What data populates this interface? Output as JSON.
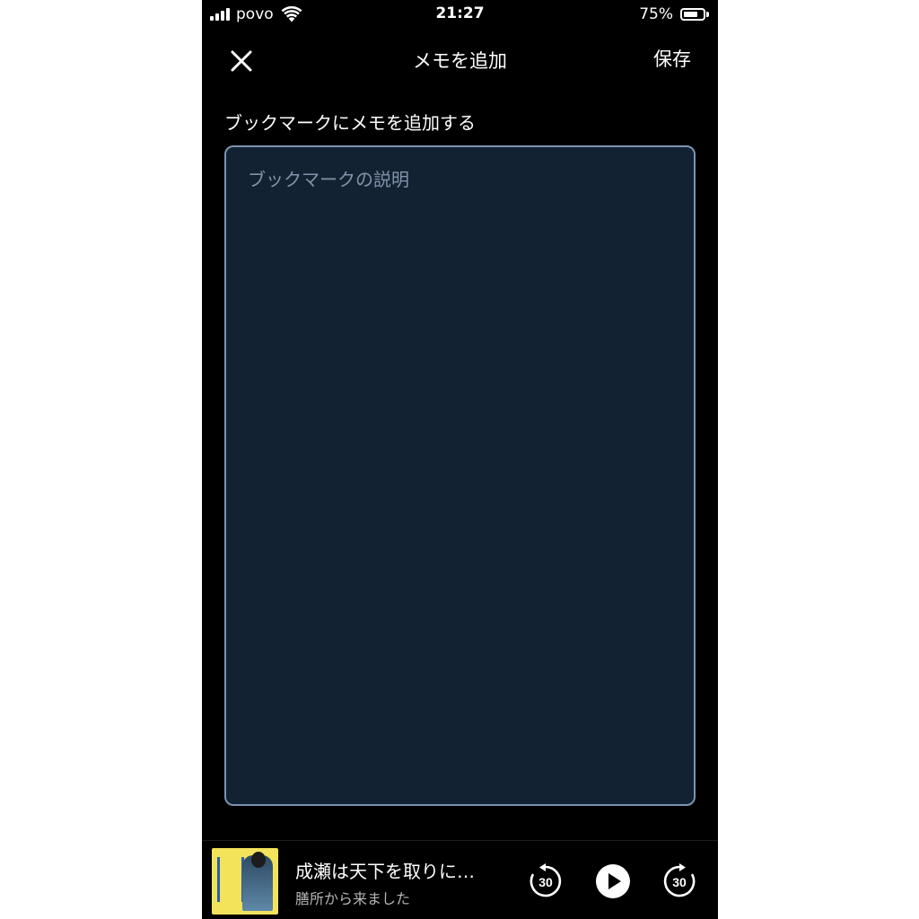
{
  "status_bar": {
    "carrier": "povo",
    "time": "21:27",
    "battery_percent_label": "75%",
    "battery_level": 0.75
  },
  "header": {
    "title": "メモを追加",
    "save_label": "保存",
    "close_icon": "close-icon"
  },
  "memo": {
    "label": "ブックマークにメモを追加する",
    "placeholder": "ブックマークの説明",
    "value": ""
  },
  "mini_player": {
    "title": "成瀬は天下を取りに…",
    "subtitle": "膳所から来ました",
    "rewind_seconds": "30",
    "forward_seconds": "30"
  },
  "colors": {
    "background": "#000000",
    "input_background": "#132233",
    "input_border": "#7b93b1",
    "placeholder": "#8193aa"
  }
}
